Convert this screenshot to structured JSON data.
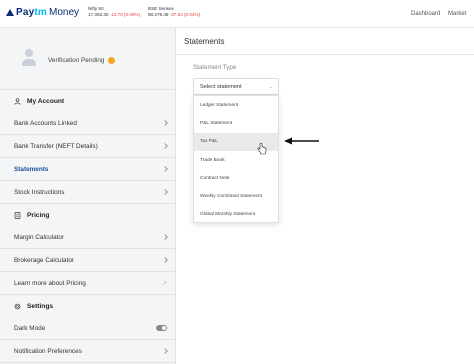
{
  "header": {
    "brand_paytm": "Pay",
    "brand_tm": "tm",
    "brand_money": "Money",
    "tickers": [
      {
        "name": "Nifty 50",
        "value": "17,363.30",
        "change": "-13.70 (0.09%)"
      },
      {
        "name": "BSE Sensex",
        "value": "58,279.48",
        "change": "-37.63 (0.03%)"
      }
    ],
    "nav": {
      "dashboard": "Dashboard",
      "market": "Market"
    }
  },
  "sidebar": {
    "verification": "Verification Pending",
    "my_account": "My Account",
    "account_items": [
      {
        "label": "Bank Accounts Linked"
      },
      {
        "label": "Bank Transfer (NEFT Details)"
      },
      {
        "label": "Statements"
      },
      {
        "label": "Stock Instructions"
      }
    ],
    "pricing": "Pricing",
    "pricing_items": [
      {
        "label": "Margin Calculator"
      },
      {
        "label": "Brokerage Calculator"
      },
      {
        "label": "Learn more about Pricing"
      }
    ],
    "settings": "Settings",
    "settings_items": [
      {
        "label": "Dark Mode"
      },
      {
        "label": "Notification Preferences"
      }
    ]
  },
  "main": {
    "title": "Statements",
    "statement_type_label": "Statement Type",
    "select_placeholder": "Select statement",
    "options": [
      "Ledger Statement",
      "P&L Statement",
      "Tax P&L",
      "Trade Book",
      "Contract Note",
      "Weekly Combined Statement",
      "Global Monthly Statement"
    ]
  },
  "colors": {
    "brand_blue": "#0a2c7a",
    "brand_cyan": "#00b9f1",
    "active_link": "#1b4e9b",
    "negative": "#e0433b",
    "pending_badge": "#f5a623"
  }
}
